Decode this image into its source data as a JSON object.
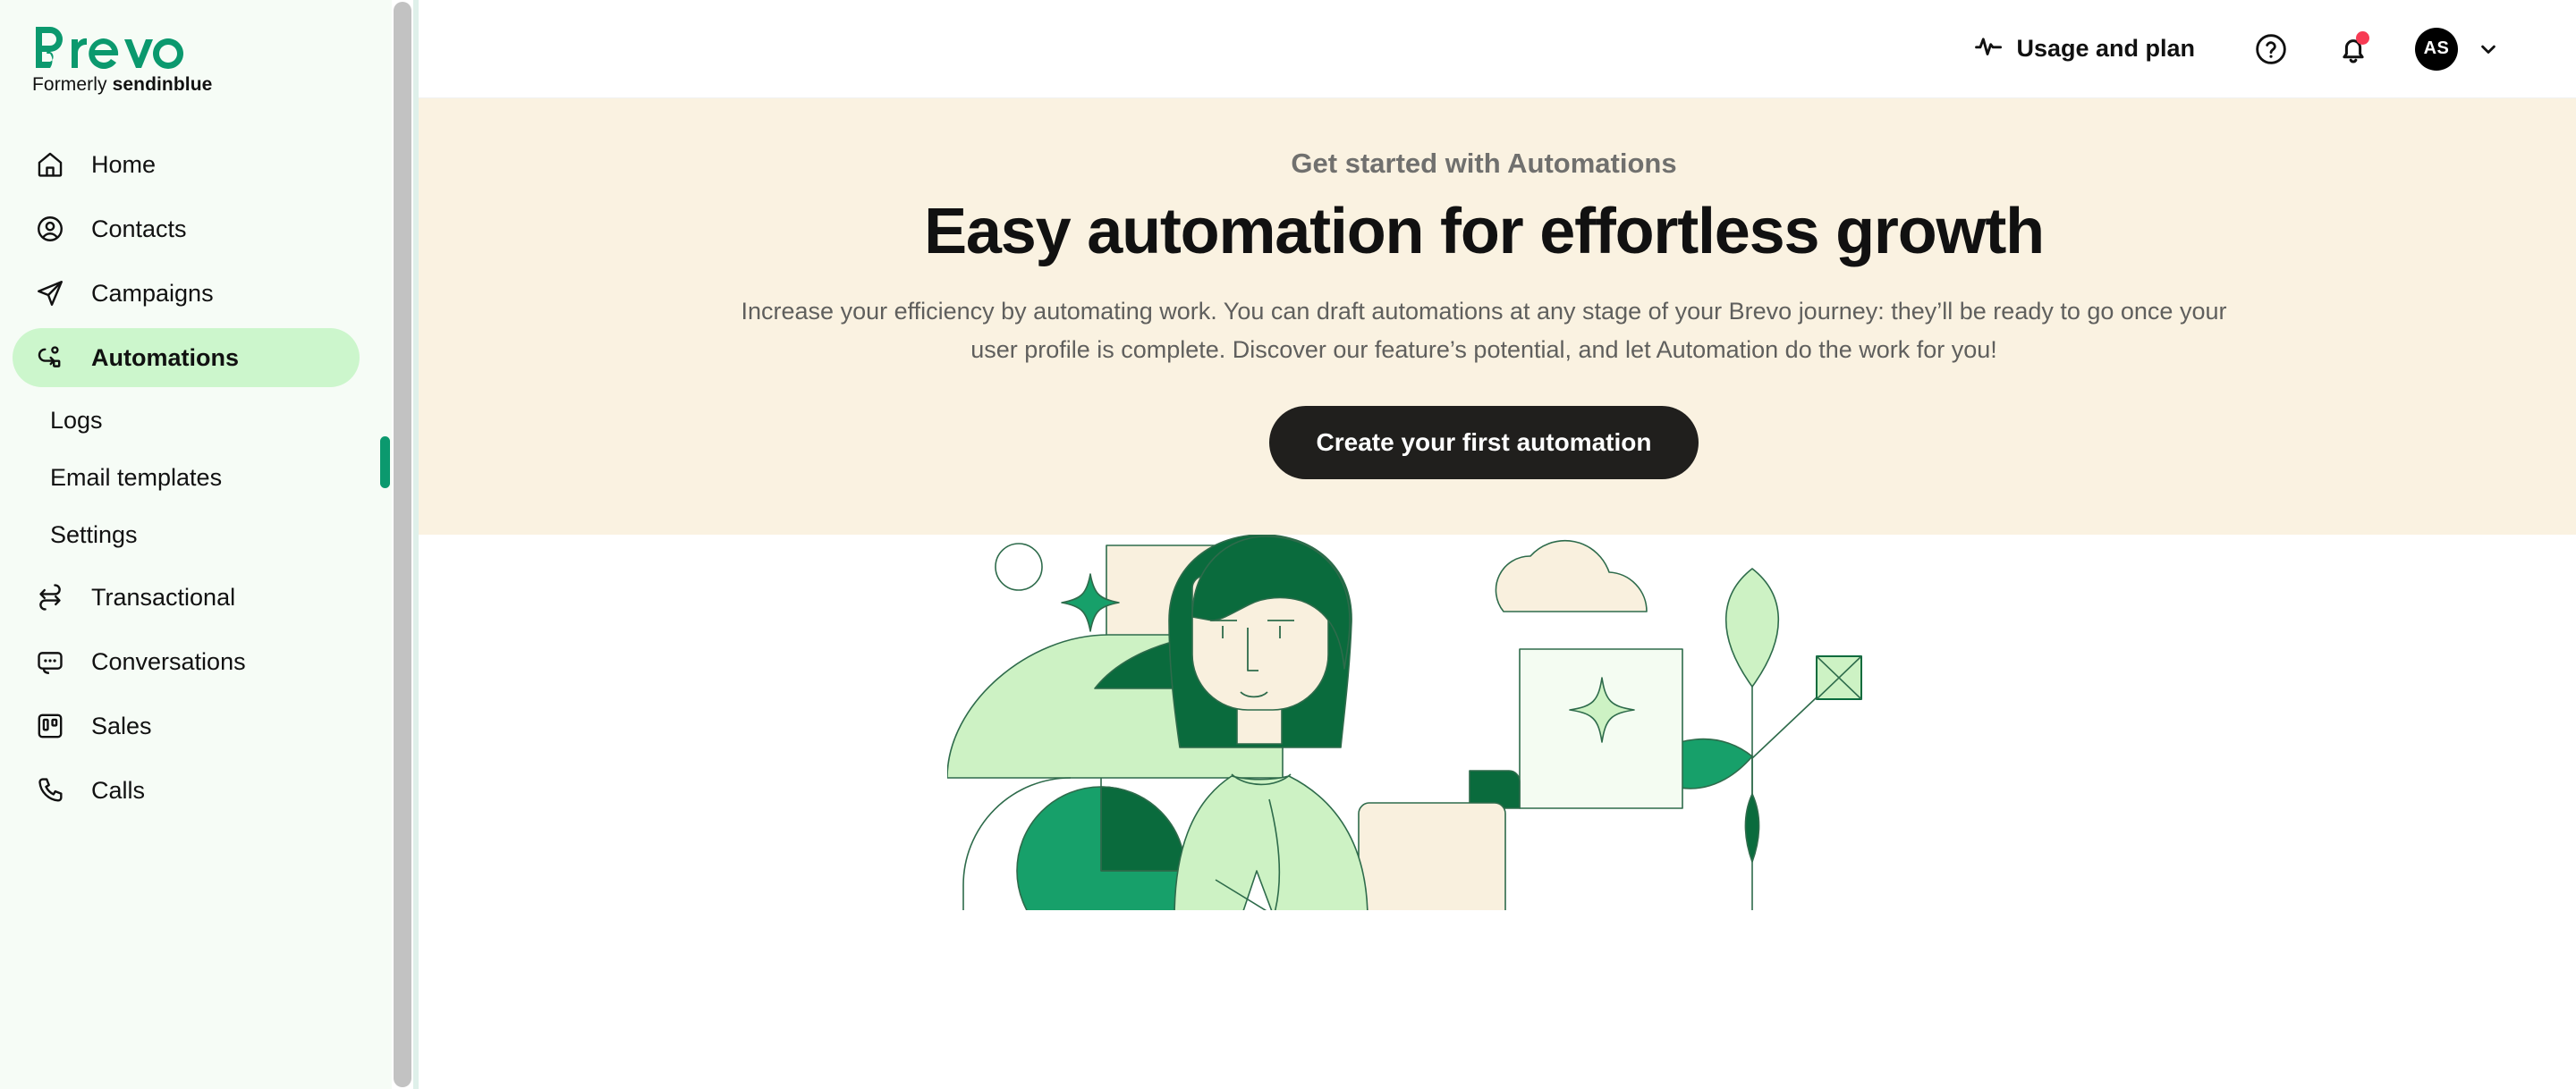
{
  "brand": {
    "name": "Brevo",
    "tagline_prefix": "Formerly ",
    "tagline_bold": "sendinblue",
    "color": "#0b996e"
  },
  "sidebar": {
    "items": [
      {
        "label": "Home",
        "icon": "home-icon",
        "type": "item",
        "active": false
      },
      {
        "label": "Contacts",
        "icon": "contacts-icon",
        "type": "item",
        "active": false
      },
      {
        "label": "Campaigns",
        "icon": "campaigns-icon",
        "type": "item",
        "active": false
      },
      {
        "label": "Automations",
        "icon": "automations-icon",
        "type": "item",
        "active": true
      },
      {
        "label": "Logs",
        "icon": "",
        "type": "sub",
        "active": false
      },
      {
        "label": "Email templates",
        "icon": "",
        "type": "sub",
        "active": false
      },
      {
        "label": "Settings",
        "icon": "",
        "type": "sub",
        "active": false
      },
      {
        "label": "Transactional",
        "icon": "transactional-icon",
        "type": "item",
        "active": false
      },
      {
        "label": "Conversations",
        "icon": "conversations-icon",
        "type": "item",
        "active": false
      },
      {
        "label": "Sales",
        "icon": "sales-icon",
        "type": "item",
        "active": false
      },
      {
        "label": "Calls",
        "icon": "calls-icon",
        "type": "item",
        "active": false
      }
    ],
    "active_highlight_color": "#ccf6cc",
    "active_marker_color": "#0b996e",
    "background": "#f6fcf6"
  },
  "topbar": {
    "usage_label": "Usage and plan",
    "usage_icon": "activity-pulse-icon",
    "help_icon": "help-circle-icon",
    "notifications_icon": "bell-icon",
    "notifications_has_unread": true,
    "notification_dot_color": "#f73b54",
    "avatar_initials": "AS",
    "avatar_background": "#000000",
    "account_chevron_icon": "chevron-down-icon"
  },
  "hero": {
    "eyebrow": "Get started with Automations",
    "title": "Easy automation for effortless growth",
    "body": "Increase your efficiency by automating work. You can draft automations at any stage of your Brevo journey: they’ll be ready to go once your user profile is complete. Discover our feature’s potential, and let Automation do the work for you!",
    "cta_label": "Create your first automation",
    "background": "#faf2e1",
    "cta_background": "#201f1d"
  },
  "illustration": {
    "name": "automation-hero-illustration",
    "description": "Woman with dark green hair working at a desk surrounded by abstract green geometric shapes, leaves, clouds and sparkles",
    "palette": {
      "dark_green": "#0a6b3d",
      "mid_green": "#17a06a",
      "light_green": "#cdf2c4",
      "pale_green": "#f4fcf2",
      "cream": "#f9f0de",
      "outline": "#2e6b4b"
    }
  }
}
